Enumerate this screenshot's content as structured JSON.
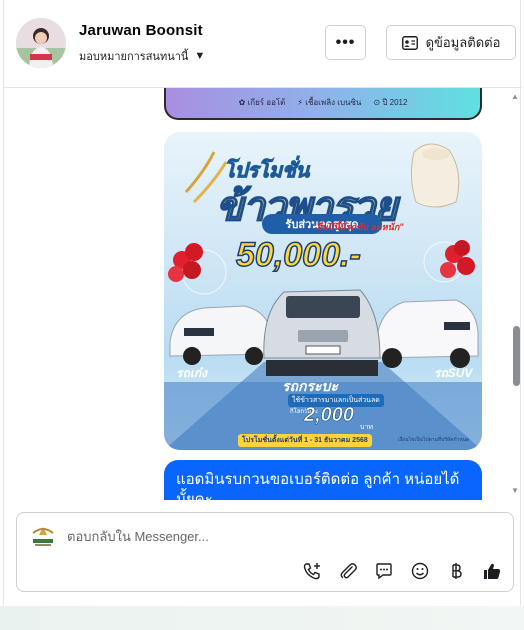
{
  "header": {
    "contact_name": "Jaruwan Boonsit",
    "assign_label": "มอบหมายการสนทนานี้",
    "more_label": "•••",
    "contact_info_label": "ดูข้อมูลติดต่อ"
  },
  "previous_card": {
    "spec_gear": "✿ เกียร์ ออโต้",
    "spec_fuel": "⚡ เชื้อเพลิง เบนซิน",
    "spec_year": "⊙ ปี 2012"
  },
  "promo_image": {
    "title_line1": "โปรโมชั่น",
    "title_line2": "ข้าวพารวย",
    "tagline": "\"ลื่นปีนี้มีรถขับ ลดหนัก\"",
    "discount_label": "รับส่วนลดสูงสุด",
    "discount_amount": "50,000.-",
    "label_old_car": "รถเก๋ง",
    "label_pickup": "รถกระบะ",
    "label_suv": "รถSUV",
    "tradein_note": "ใช้ข้าวสารมาแลกเป็นส่วนลด",
    "per_kg_note": "กิโลกรัมละ",
    "price_per_kg": "2,000",
    "baht": "บาท",
    "date_range": "โปรโมชั่นตั้งแต่วันที่ 1 - 31 ธันวาคม 2568",
    "conditions": "เงื่อนไขเป็นไปตามที่บริษัทกำหนด"
  },
  "message_bubble": {
    "text": "แอดมินรบกวนขอเบอร์ติดต่อ ลูกค้า หน่อยได้มั้ยคะ"
  },
  "composer": {
    "placeholder": "ตอบกลับใน Messenger..."
  },
  "colors": {
    "accent": "#0866ff",
    "border": "#ccd0d5"
  }
}
